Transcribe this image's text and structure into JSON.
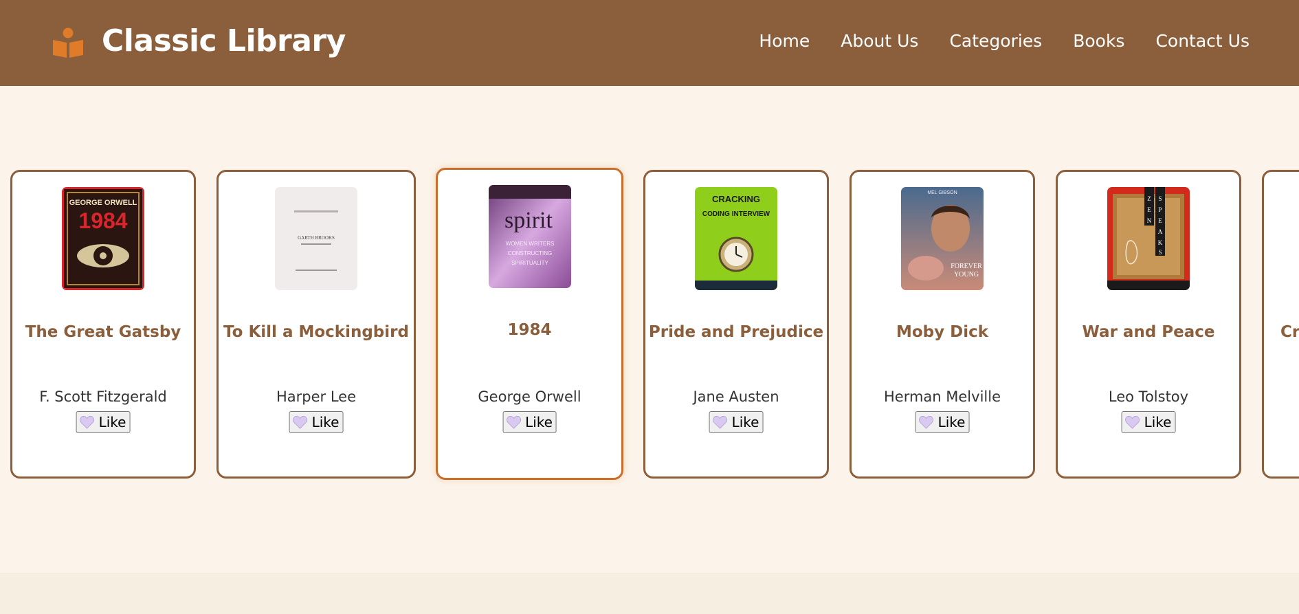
{
  "header": {
    "brand": "Classic Library",
    "logo_icon": "book-reader-icon",
    "nav": [
      "Home",
      "About Us",
      "Categories",
      "Books",
      "Contact Us"
    ],
    "colors": {
      "header_bg": "#8b5e3c",
      "page_bg": "#fcf4ea",
      "accent": "#c96f2b"
    }
  },
  "books": [
    {
      "title": "The Great Gatsby",
      "author": "F. Scott Fitzgerald",
      "like_label": "Like",
      "cover_text": "GEORGE ORWELL 1984"
    },
    {
      "title": "To Kill a Mockingbird",
      "author": "Harper Lee",
      "like_label": "Like",
      "cover_text": "GARTH BROOKS"
    },
    {
      "title": "1984",
      "author": "George Orwell",
      "like_label": "Like",
      "cover_text": "spirit"
    },
    {
      "title": "Pride and Prejudice",
      "author": "Jane Austen",
      "like_label": "Like",
      "cover_text": "CRACKING the CODING INTERVIEW"
    },
    {
      "title": "Moby Dick",
      "author": "Herman Melville",
      "like_label": "Like",
      "cover_text": "MEL GIBSON"
    },
    {
      "title": "War and Peace",
      "author": "Leo Tolstoy",
      "like_label": "Like",
      "cover_text": "ZEN SPEAKS"
    },
    {
      "title": "Cri",
      "author": "",
      "like_label": "",
      "cover_text": ""
    }
  ]
}
